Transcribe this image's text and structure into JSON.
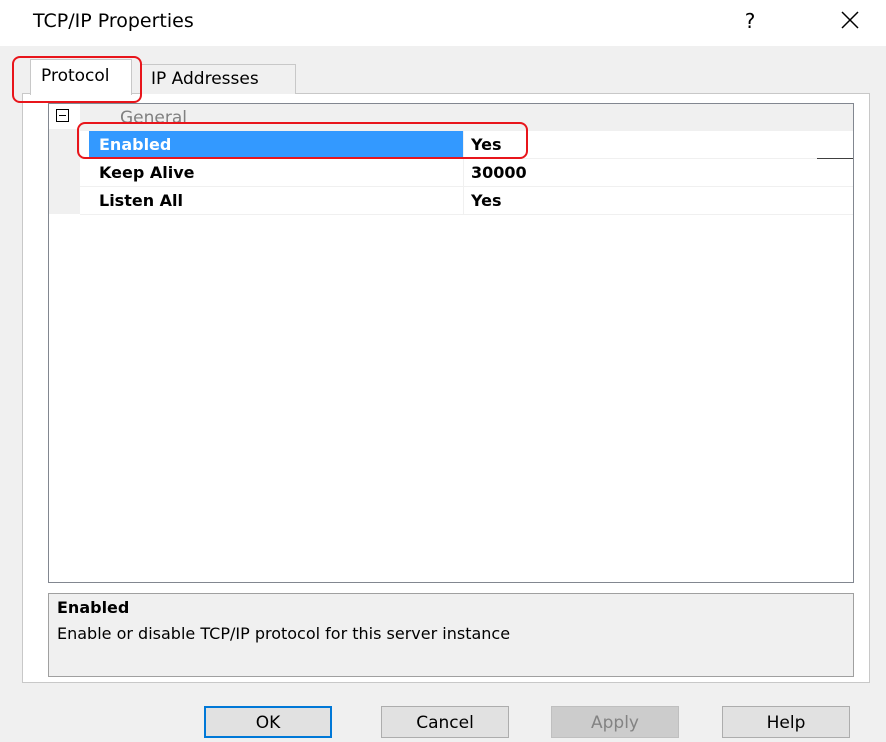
{
  "window": {
    "title": "TCP/IP Properties",
    "help_label": "?",
    "close_icon": "close-icon"
  },
  "tabs": [
    {
      "label": "Protocol",
      "active": true
    },
    {
      "label": "IP Addresses",
      "active": false
    }
  ],
  "grid": {
    "category": {
      "label": "General",
      "expanded": true
    },
    "properties": [
      {
        "name": "Enabled",
        "value": "Yes",
        "selected": true
      },
      {
        "name": "Keep Alive",
        "value": "30000",
        "selected": false
      },
      {
        "name": "Listen All",
        "value": "Yes",
        "selected": false
      }
    ]
  },
  "description": {
    "title": "Enabled",
    "text": "Enable or disable TCP/IP protocol for this server instance"
  },
  "buttons": {
    "ok": "OK",
    "cancel": "Cancel",
    "apply": "Apply",
    "help": "Help"
  },
  "colors": {
    "selection": "#3399ff",
    "annotation": "#e8151b",
    "default_button_border": "#0078d7"
  }
}
